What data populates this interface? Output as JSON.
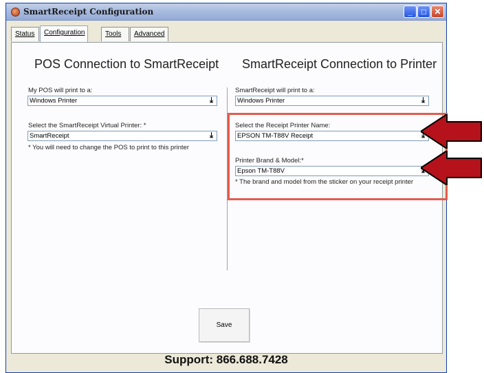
{
  "window": {
    "title": "SmartReceipt Configuration",
    "controls": {
      "minimize": "_",
      "maximize": "□",
      "close": "✕"
    }
  },
  "tabs": [
    {
      "label": "Status",
      "active": false
    },
    {
      "label": "Configuration",
      "active": true
    },
    {
      "label": "Tools",
      "active": false
    },
    {
      "label": "Advanced",
      "active": false
    }
  ],
  "left": {
    "heading": "POS Connection to SmartReceipt",
    "pos_label": "My POS will print to a:",
    "pos_value": "Windows Printer",
    "virtual_label": "Select the SmartReceipt Virtual Printer: *",
    "virtual_value": "SmartReceipt",
    "virtual_note": "* You will need to change the POS to print to this printer"
  },
  "right": {
    "heading": "SmartReceipt Connection to Printer",
    "print_label": "SmartReceipt will print to a:",
    "print_value": "Windows Printer",
    "printer_name_label": "Select the Receipt Printer Name:",
    "printer_name_value": "EPSON TM-T88V Receipt",
    "model_label": "Printer Brand & Model:*",
    "model_value": "Epson TM-T88V",
    "model_note": "* The brand and model from the sticker on your receipt printer"
  },
  "dropdown_glyph": "⤓",
  "save_label": "Save",
  "support_text": "Support:  866.688.7428",
  "colors": {
    "highlight": "#e35b4c",
    "arrow": "#b5121b"
  }
}
